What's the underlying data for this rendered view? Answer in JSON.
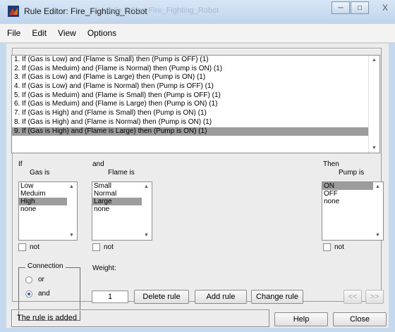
{
  "window": {
    "title": "Rule Editor: Fire_Fighting_Robot",
    "ghost_title": "Rule Editor: Fire_Fighting_Robot",
    "buttons": {
      "minimize": "─",
      "maximize": "□",
      "close": "X"
    }
  },
  "menu": [
    "File",
    "Edit",
    "View",
    "Options"
  ],
  "rules": [
    "1. If (Gas is Low) and (Flame is Small) then (Pump is OFF) (1)",
    "2. If (Gas is Meduim) and (Flame is Normal) then (Pump is ON) (1)",
    "3. If (Gas is Low) and (Flame is Large) then (Pump is ON) (1)",
    "4. If (Gas is Low) and (Flame is Normal) then (Pump is OFF) (1)",
    "5. If (Gas is Meduim) and (Flame is Small) then (Pump is OFF) (1)",
    "6. If (Gas is Meduim) and (Flame is Large) then (Pump is ON) (1)",
    "7. If (Gas is High) and (Flame is Small) then (Pump is ON) (1)",
    "8. If (Gas is High) and (Flame is Normal) then (Pump is ON) (1)",
    "9. If (Gas is High) and (Flame is Large) then (Pump is ON) (1)"
  ],
  "selected_rule": 8,
  "antecedent": {
    "if_label": "If",
    "gas_label": "Gas is",
    "gas_options": [
      "Low",
      "Meduim",
      "High",
      "none"
    ],
    "gas_selected": 2,
    "and_label": "and",
    "flame_label": "Flame is",
    "flame_options": [
      "Small",
      "Normal",
      "Large",
      "none"
    ],
    "flame_selected": 2
  },
  "consequent": {
    "then_label": "Then",
    "pump_label": "Pump is",
    "pump_options": [
      "ON",
      "OFF",
      "none"
    ],
    "pump_selected": 0
  },
  "not_label": "not",
  "connection": {
    "title": "Connection",
    "or_label": "or",
    "and_label": "and",
    "selected": "and"
  },
  "weight": {
    "label": "Weight:",
    "value": "1"
  },
  "buttons": {
    "delete_rule": "Delete rule",
    "add_rule": "Add rule",
    "change_rule": "Change rule",
    "prev": "<<",
    "next": ">>",
    "help": "Help",
    "close": "Close"
  },
  "status": "The rule is added"
}
